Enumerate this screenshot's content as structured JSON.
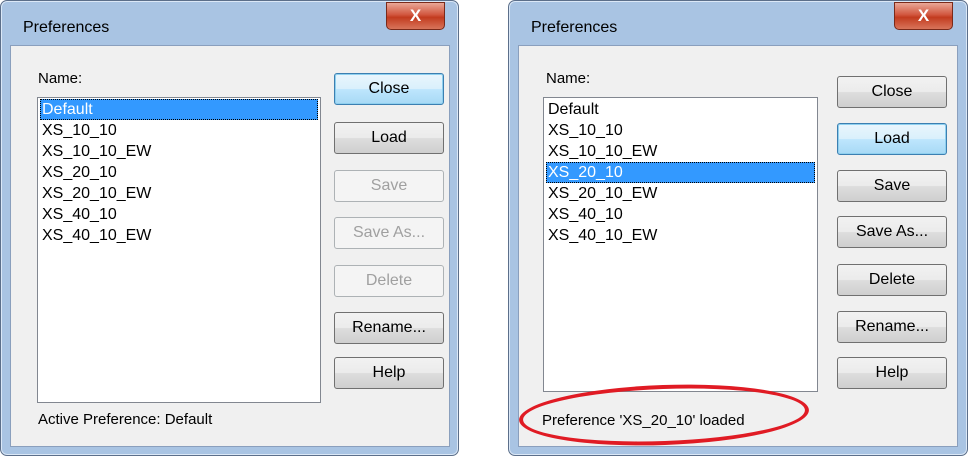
{
  "dialogs": [
    {
      "title": "Preferences",
      "close_glyph": "X",
      "name_label": "Name:",
      "list_items": [
        "Default",
        "XS_10_10",
        "XS_10_10_EW",
        "XS_20_10",
        "XS_20_10_EW",
        "XS_40_10",
        "XS_40_10_EW"
      ],
      "selected_item": "Default",
      "buttons": {
        "close": "Close",
        "load": "Load",
        "save": "Save",
        "save_as": "Save As...",
        "delete": "Delete",
        "rename": "Rename...",
        "help": "Help"
      },
      "disabled_buttons": [
        "save",
        "save_as",
        "delete"
      ],
      "status_text": "Active Preference: Default"
    },
    {
      "title": "Preferences",
      "close_glyph": "X",
      "name_label": "Name:",
      "list_items": [
        "Default",
        "XS_10_10",
        "XS_10_10_EW",
        "XS_20_10",
        "XS_20_10_EW",
        "XS_40_10",
        "XS_40_10_EW"
      ],
      "selected_item": "XS_20_10",
      "buttons": {
        "close": "Close",
        "load": "Load",
        "save": "Save",
        "save_as": "Save As...",
        "delete": "Delete",
        "rename": "Rename...",
        "help": "Help"
      },
      "disabled_buttons": [],
      "status_text": "Preference 'XS_20_10' loaded",
      "status_highlight_color": "#e01b24"
    }
  ],
  "colors": {
    "selection": "#3399ff",
    "frame": "#a9c4e3",
    "client": "#f0f0f0",
    "close_button": "#c23b1f"
  }
}
